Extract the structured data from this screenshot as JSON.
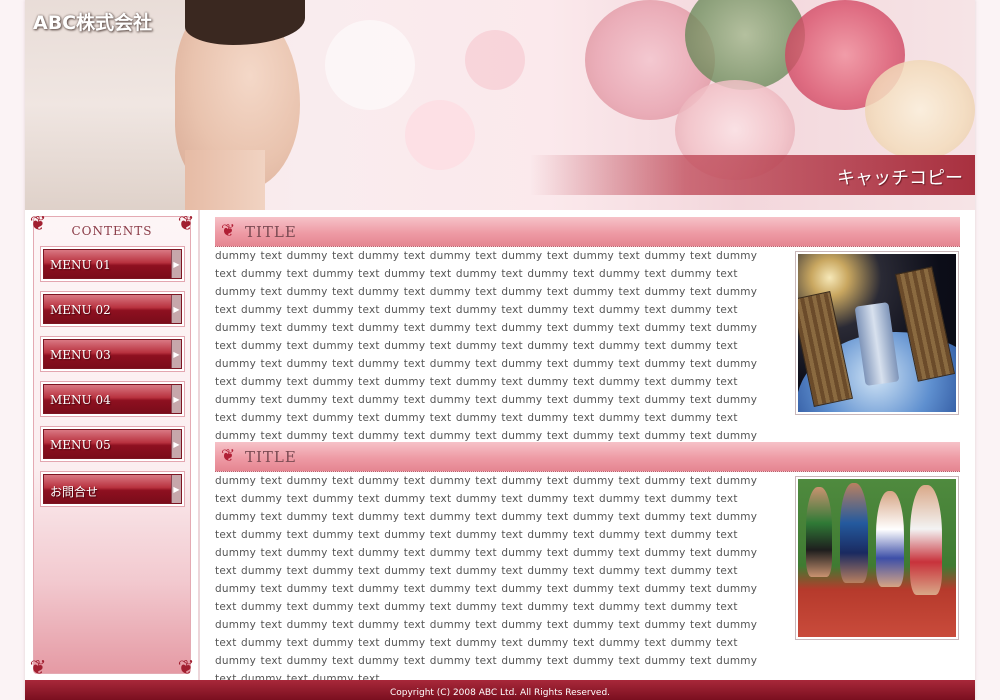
{
  "header": {
    "logo": "ABC株式会社",
    "catch_copy": "キャッチコピー"
  },
  "sidebar": {
    "contents_label": "CONTENTS",
    "menu": [
      {
        "label": "MENU 01"
      },
      {
        "label": "MENU 02"
      },
      {
        "label": "MENU 03"
      },
      {
        "label": "MENU 04"
      },
      {
        "label": "MENU 05"
      },
      {
        "label": "お問合せ"
      }
    ]
  },
  "sections": [
    {
      "title": "TITLE",
      "text": "dummy text dummy text dummy text dummy text dummy text dummy text dummy text dummy text dummy text dummy text dummy text dummy text dummy text dummy text dummy text dummy text dummy text dummy text dummy text dummy text dummy text dummy text dummy text dummy text dummy text dummy text dummy text dummy text dummy text dummy text dummy text dummy text dummy text dummy text dummy text dummy text dummy text dummy text dummy text dummy text dummy text dummy text dummy text dummy text dummy text dummy text dummy text dummy text dummy text dummy text dummy text dummy text dummy text dummy text dummy text dummy text dummy text dummy text dummy text dummy text dummy text dummy text dummy text dummy text dummy text dummy text dummy text dummy text dummy text dummy text dummy text dummy text dummy text dummy text dummy text dummy text dummy text dummy text dummy text dummy text dummy text dummy text dummy text dummy text"
    },
    {
      "title": "TITLE",
      "text": "dummy text dummy text dummy text dummy text dummy text dummy text dummy text dummy text dummy text dummy text dummy text dummy text dummy text dummy text dummy text dummy text dummy text dummy text dummy text dummy text dummy text dummy text dummy text dummy text dummy text dummy text dummy text dummy text dummy text dummy text dummy text dummy text dummy text dummy text dummy text dummy text dummy text dummy text dummy text dummy text dummy text dummy text dummy text dummy text dummy text dummy text dummy text dummy text dummy text dummy text dummy text dummy text dummy text dummy text dummy text dummy text dummy text dummy text dummy text dummy text dummy text dummy text dummy text dummy text dummy text dummy text dummy text dummy text dummy text dummy text dummy text dummy text dummy text dummy text dummy text dummy text dummy text dummy text dummy text dummy text dummy text dummy text dummy text dummy text dummy text"
    }
  ],
  "footer": {
    "copyright": "Copyright (C) 2008 ABC Ltd. All Rights Reserved."
  },
  "icons": {
    "section_marker": "heart-ornament-icon",
    "menu_arrow": "triangle-right-icon",
    "corner": "flourish-ornament-icon"
  },
  "colors": {
    "accent": "#8e1020",
    "accent_light": "#ee9ba5",
    "background": "#fbf3f5"
  }
}
